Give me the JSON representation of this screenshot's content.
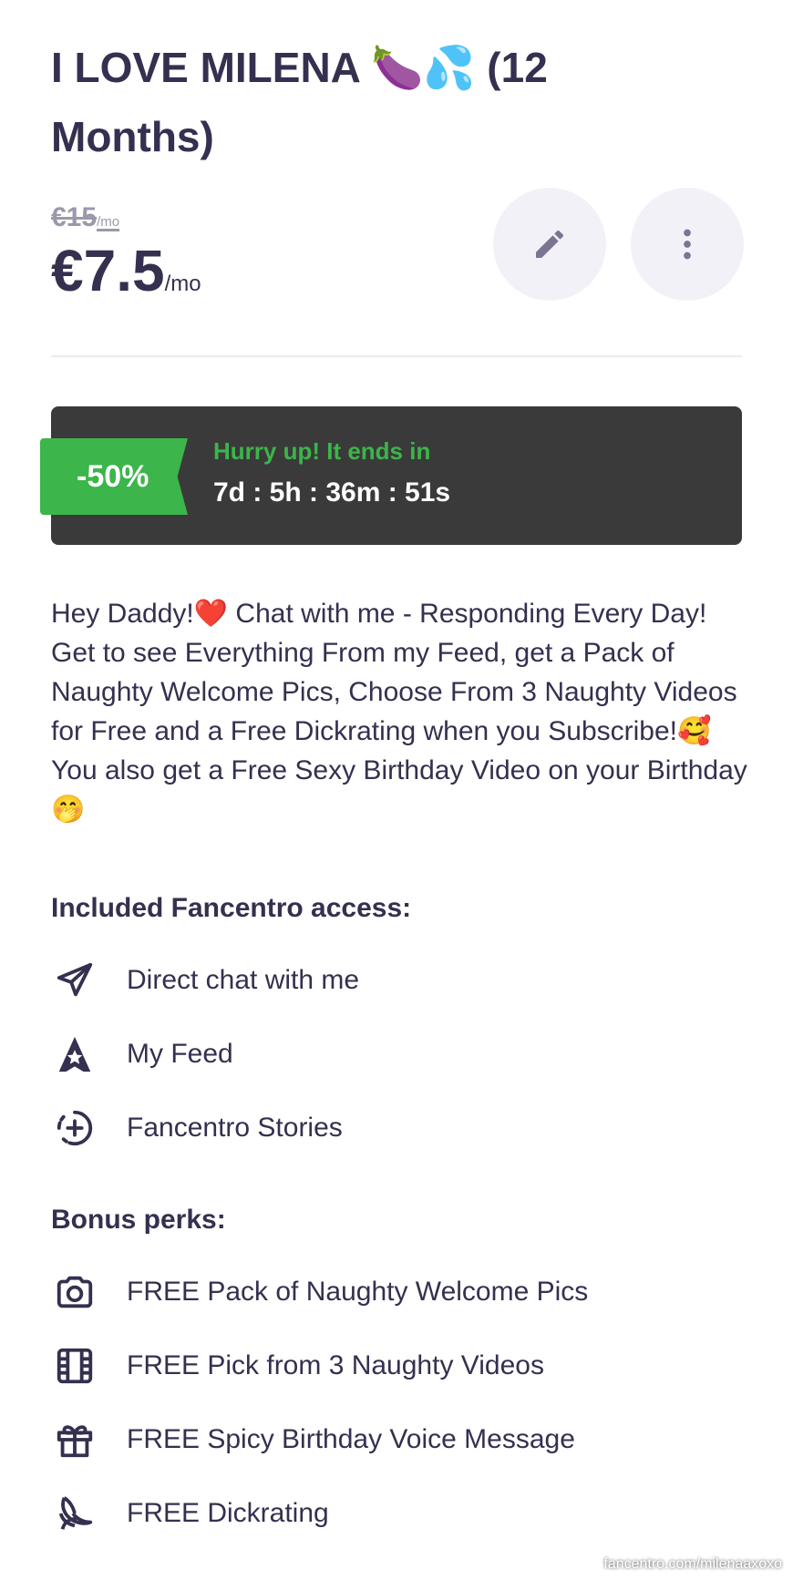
{
  "header": {
    "title": "I LOVE MILENA 🍆💦 (12 Months)"
  },
  "pricing": {
    "old_price": "€15",
    "old_unit": "/mo",
    "price": "€7.5",
    "unit": "/mo"
  },
  "actions": {
    "edit_icon": "pencil-icon",
    "more_icon": "more-vertical-icon"
  },
  "promo": {
    "badge": "-50%",
    "hurry_text": "Hurry up! It ends in",
    "countdown": "7d : 5h : 36m : 51s",
    "colors": {
      "badge": "#3cb54a",
      "panel": "#3a3a3a"
    }
  },
  "description": "Hey Daddy!❤️ Chat with me - Responding Every Day! Get to see Everything From my Feed, get a Pack of Naughty Welcome Pics, Choose From 3 Naughty Videos for Free and a Free Dickrating when you Subscribe!🥰 You also get a Free Sexy Birthday Video on your Birthday🤭",
  "access": {
    "title": "Included Fancentro access:",
    "items": [
      {
        "icon": "paper-plane-icon",
        "label": "Direct chat with me"
      },
      {
        "icon": "star-badge-icon",
        "label": "My Feed"
      },
      {
        "icon": "story-plus-icon",
        "label": "Fancentro Stories"
      }
    ]
  },
  "perks": {
    "title": "Bonus perks:",
    "items": [
      {
        "icon": "camera-icon",
        "label": "FREE Pack of Naughty Welcome Pics"
      },
      {
        "icon": "film-icon",
        "label": "FREE Pick from 3 Naughty Videos"
      },
      {
        "icon": "gift-icon",
        "label": "FREE Spicy Birthday Voice Message"
      },
      {
        "icon": "banana-icon",
        "label": "FREE Dickrating"
      }
    ]
  },
  "watermark": "fancentro.com/milenaaxoxo"
}
